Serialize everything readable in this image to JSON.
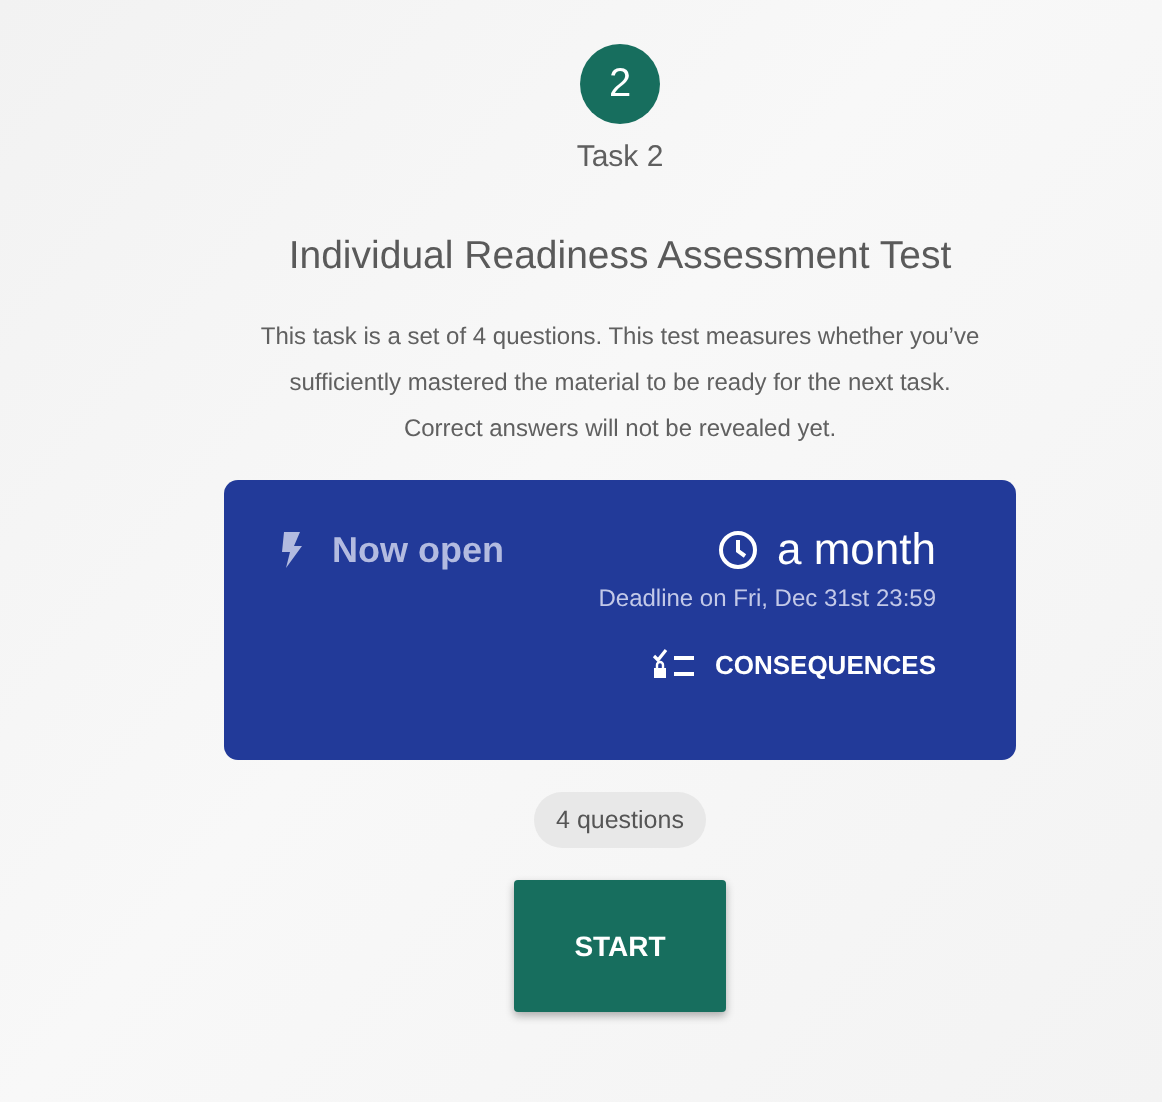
{
  "step": {
    "number": "2",
    "label": "Task 2"
  },
  "title": "Individual Readiness Assessment Test",
  "description": "This task is a set of 4 questions. This test measures whether you’ve sufficiently mastered the material to be ready for the next task. Correct answers will not be revealed yet.",
  "status_card": {
    "status": "Now open",
    "open": true,
    "time_left": "a month",
    "deadline": "Deadline on Fri, Dec 31st 23:59",
    "consequences_link": "CONSEQUENCES"
  },
  "question_count": "4 questions",
  "start_button": "START"
}
